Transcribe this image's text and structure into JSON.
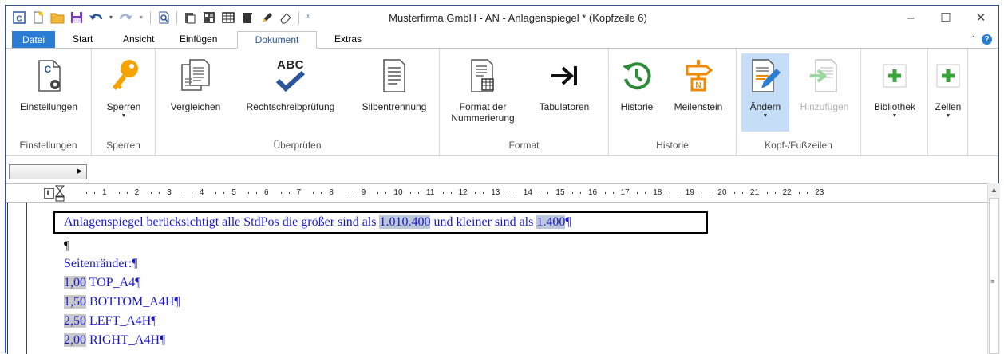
{
  "window": {
    "title": "Musterfirma GmbH - AN - Anlagenspiegel * (Kopfzeile 6)",
    "controls": {
      "minimize": "–",
      "maximize": "☐",
      "close": "✕"
    }
  },
  "qat": {
    "icons": [
      "app-icon",
      "new-icon",
      "open-icon",
      "save-icon",
      "undo-icon",
      "redo-icon",
      "print-preview-icon",
      "paste-icon",
      "format-icon",
      "table-icon",
      "delete-icon",
      "pen-icon",
      "eraser-icon",
      "customize-icon"
    ]
  },
  "tabs": [
    "Datei",
    "Start",
    "Ansicht",
    "Einfügen",
    "Dokument",
    "Extras"
  ],
  "active_tab": "Dokument",
  "ribbon": {
    "groups": {
      "einstellungen": {
        "label": "Einstellungen",
        "buttons": {
          "einstellungen": "Einstellungen"
        }
      },
      "sperren": {
        "label": "Sperren",
        "buttons": {
          "sperren": "Sperren"
        }
      },
      "ueberpruefen": {
        "label": "Überprüfen",
        "buttons": {
          "vergleichen": "Vergleichen",
          "rechtschreibpruefung": "Rechtschreibprüfung",
          "silbentrennung": "Silbentrennung"
        }
      },
      "format": {
        "label": "Format",
        "buttons": {
          "nummerierung_l1": "Format der",
          "nummerierung_l2": "Nummerierung",
          "tabulatoren": "Tabulatoren"
        }
      },
      "historie": {
        "label": "Historie",
        "buttons": {
          "historie": "Historie",
          "meilenstein": "Meilenstein"
        }
      },
      "kopf_fuss": {
        "label": "Kopf-/Fußzeilen",
        "buttons": {
          "aendern": "Ändern",
          "hinzufuegen": "Hinzufügen"
        }
      },
      "extra": {
        "buttons": {
          "bibliothek": "Bibliothek",
          "zellen": "Zellen"
        }
      }
    },
    "rechtschreibpruefung_icon_text": "ABC"
  },
  "ruler": {
    "tabstop": "L",
    "numbers": [
      "1",
      "2",
      "3",
      "4",
      "5",
      "6",
      "7",
      "8",
      "9",
      "10",
      "11",
      "12",
      "13",
      "14",
      "15",
      "16",
      "17",
      "18",
      "19",
      "20",
      "21",
      "22",
      "23"
    ]
  },
  "document": {
    "line1": {
      "part1": "Anlagenspiegel berücksichtigt alle StdPos die größer sind als ",
      "value1": "1.010.400",
      "part2": " und kleiner sind als ",
      "value2": "1.400",
      "pilcrow": "¶"
    },
    "empty_line": "¶",
    "seitenraender": "Seitenränder:¶",
    "margins": [
      {
        "value": "1,00",
        "name": " TOP_A4¶"
      },
      {
        "value": "1,50",
        "name": " BOTTOM_A4H¶"
      },
      {
        "value": "2,50",
        "name": " LEFT_A4H¶"
      },
      {
        "value": "2,00",
        "name": " RIGHT_A4H¶"
      }
    ]
  },
  "colors": {
    "accent": "#2b579a",
    "file_tab": "#2b7cd3",
    "doc_text": "#1a1acc",
    "green": "#3aa43a",
    "orange": "#f08a00"
  }
}
